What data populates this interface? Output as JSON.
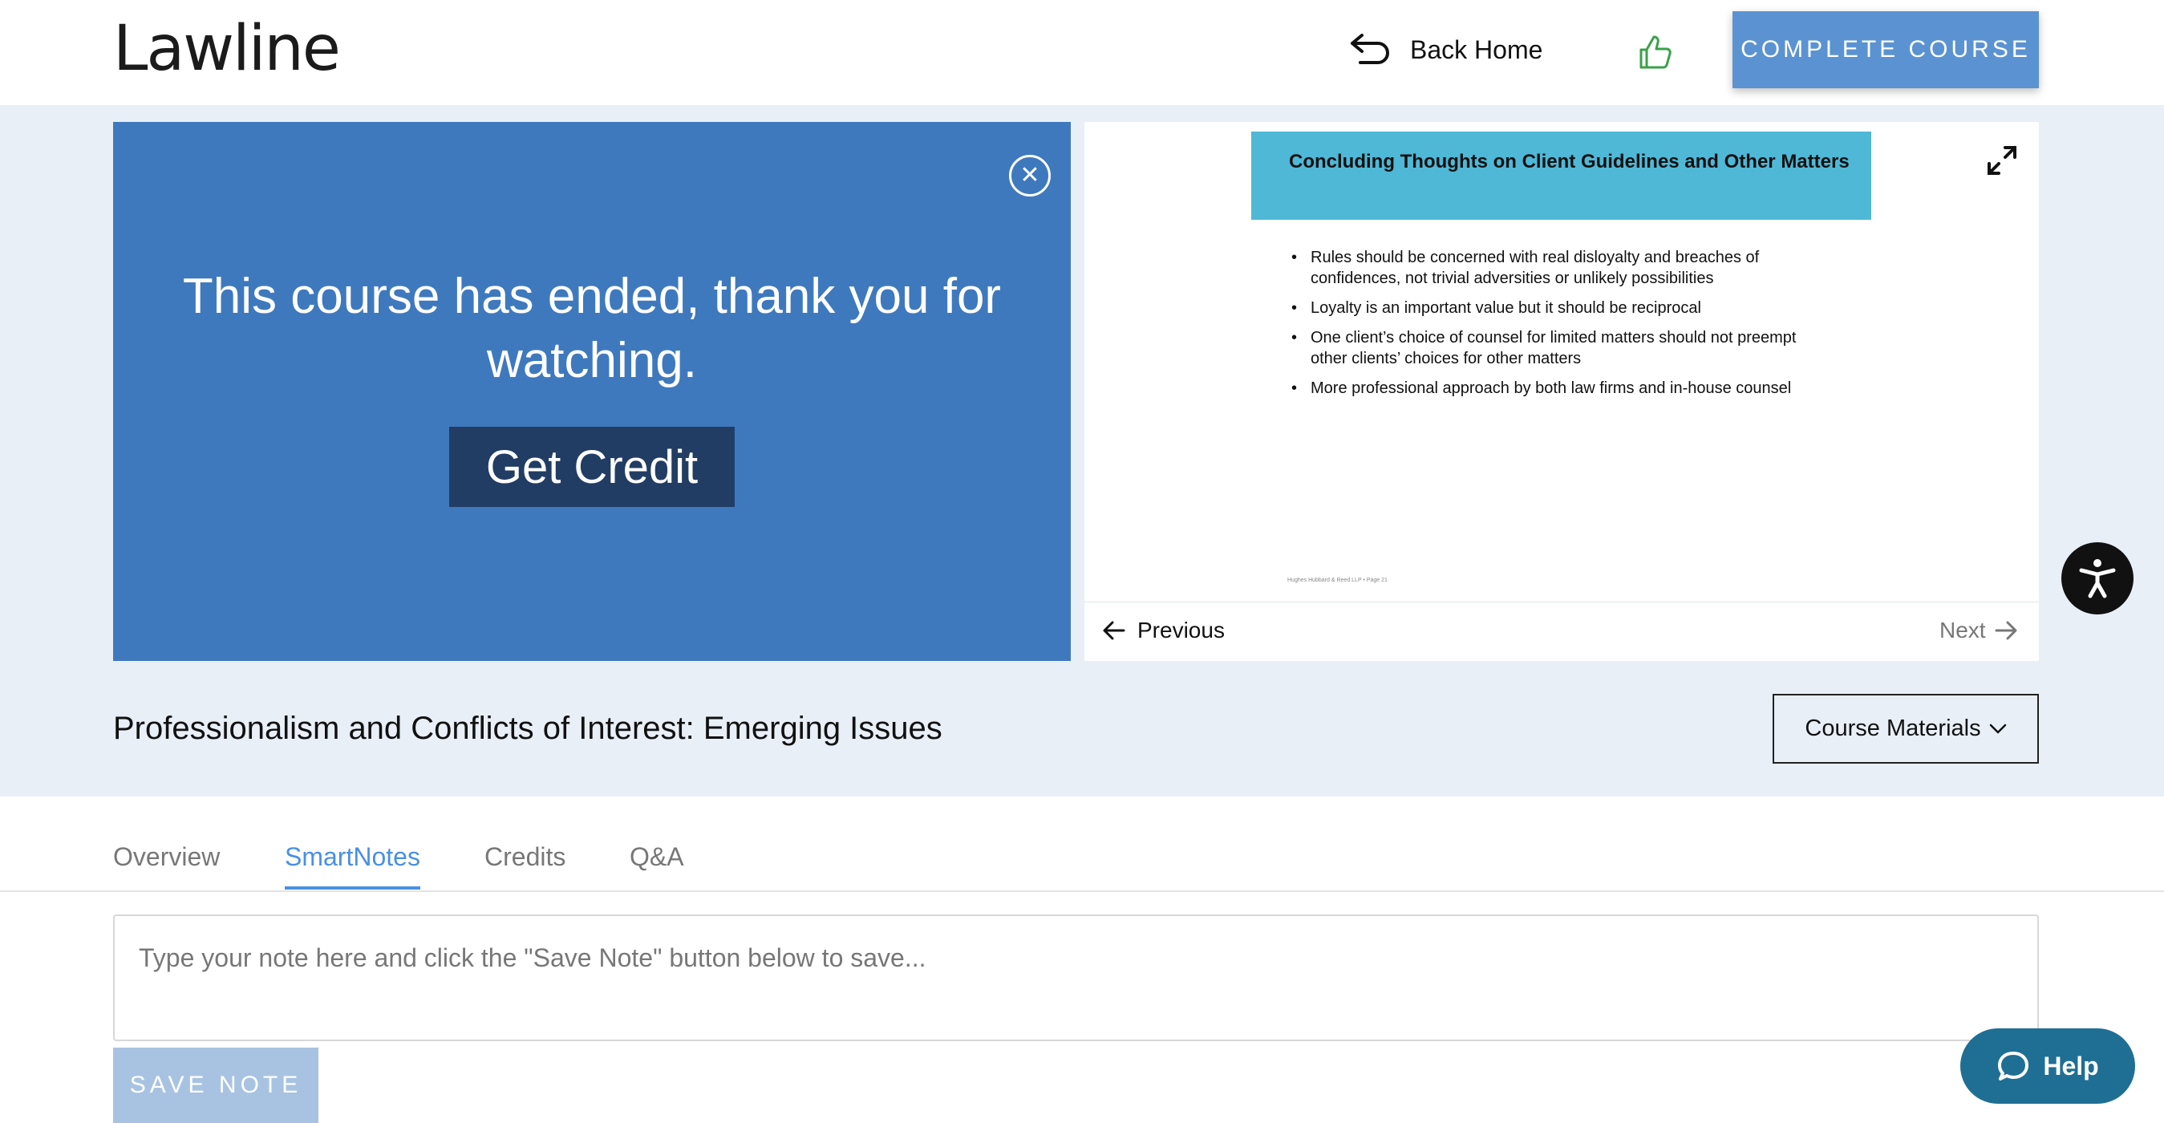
{
  "header": {
    "logo_text": "Lawline",
    "back_home_label": "Back Home",
    "complete_course_label": "COMPLETE COURSE"
  },
  "video": {
    "ended_message": "This course has ended, thank you for watching.",
    "get_credit_label": "Get Credit"
  },
  "slide": {
    "title": "Concluding Thoughts on Client Guidelines and Other Matters",
    "bullets": [
      "Rules should be concerned with real disloyalty and breaches of confidences, not trivial adversities or unlikely possibilities",
      "Loyalty is an important value but it should be reciprocal",
      "One client’s choice of counsel for limited matters should not preempt other clients’ choices for other matters",
      "More professional approach by both law firms and in-house counsel"
    ],
    "footer": "Hughes Hubbard & Reed LLP • Page 21",
    "previous_label": "Previous",
    "next_label": "Next"
  },
  "course": {
    "title": "Professionalism and Conflicts of Interest: Emerging Issues",
    "materials_label": "Course Materials"
  },
  "tabs": [
    {
      "label": "Overview"
    },
    {
      "label": "SmartNotes"
    },
    {
      "label": "Credits"
    },
    {
      "label": "Q&A"
    }
  ],
  "active_tab": "SmartNotes",
  "notes": {
    "placeholder": "Type your note here and click the \"Save Note\" button below to save...",
    "save_label": "SAVE NOTE"
  },
  "help": {
    "label": "Help"
  },
  "colors": {
    "accent": "#4a90e2",
    "video_bg": "#3f79bd",
    "credit_btn": "#223d64",
    "slide_title_bg": "#4fb8d6",
    "help_bg": "#1f6f94",
    "page_band": "#e8eff7"
  },
  "icons": [
    "back-arrow-icon",
    "thumbs-up-icon",
    "close-icon",
    "expand-icon",
    "arrow-left-icon",
    "arrow-right-icon",
    "chevron-down-icon",
    "accessibility-icon",
    "chat-bubble-icon"
  ]
}
